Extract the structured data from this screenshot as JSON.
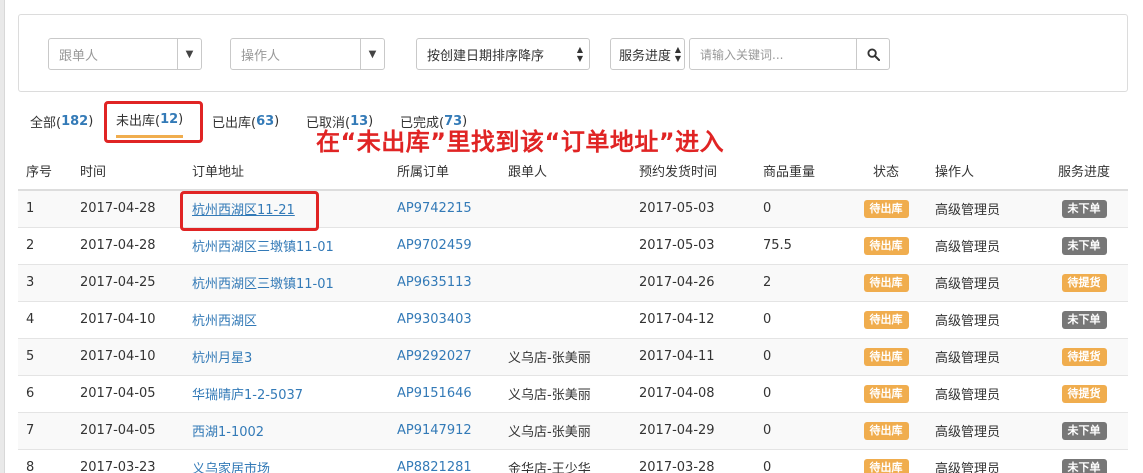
{
  "filters": {
    "follower_placeholder": "跟单人",
    "operator_placeholder": "操作人",
    "sort_value": "按创建日期排序降序",
    "progress_value": "服务进度",
    "search_placeholder": "请输入关键词..."
  },
  "tabs": [
    {
      "label": "全部(",
      "count": "182",
      "close": ")"
    },
    {
      "label": "未出库(",
      "count": "12",
      "close": ")"
    },
    {
      "label": "已出库(",
      "count": "63",
      "close": ")"
    },
    {
      "label": "已取消(",
      "count": "13",
      "close": ")"
    },
    {
      "label": "已完成(",
      "count": "73",
      "close": ")"
    }
  ],
  "annotation": "在“未出库”里找到该“订单地址”进入",
  "table": {
    "headers": [
      "序号",
      "时间",
      "订单地址",
      "所属订单",
      "跟单人",
      "预约发货时间",
      "商品重量",
      "状态",
      "操作人",
      "服务进度"
    ],
    "rows": [
      [
        "1",
        "2017-04-28",
        "杭州西湖区11-21",
        "AP9742215",
        "",
        "2017-05-03",
        "0",
        "待出库",
        "高级管理员",
        "未下单"
      ],
      [
        "2",
        "2017-04-28",
        "杭州西湖区三墩镇11-01",
        "AP9702459",
        "",
        "2017-05-03",
        "75.5",
        "待出库",
        "高级管理员",
        "未下单"
      ],
      [
        "3",
        "2017-04-25",
        "杭州西湖区三墩镇11-01",
        "AP9635113",
        "",
        "2017-04-26",
        "2",
        "待出库",
        "高级管理员",
        "待提货"
      ],
      [
        "4",
        "2017-04-10",
        "杭州西湖区",
        "AP9303403",
        "",
        "2017-04-12",
        "0",
        "待出库",
        "高级管理员",
        "未下单"
      ],
      [
        "5",
        "2017-04-10",
        "杭州月星3",
        "AP9292027",
        "义乌店-张美丽",
        "2017-04-11",
        "0",
        "待出库",
        "高级管理员",
        "待提货"
      ],
      [
        "6",
        "2017-04-05",
        "华瑞晴庐1-2-5037",
        "AP9151646",
        "义乌店-张美丽",
        "2017-04-08",
        "0",
        "待出库",
        "高级管理员",
        "待提货"
      ],
      [
        "7",
        "2017-04-05",
        "西湖1-1002",
        "AP9147912",
        "义乌店-张美丽",
        "2017-04-29",
        "0",
        "待出库",
        "高级管理员",
        "未下单"
      ],
      [
        "8",
        "2017-03-23",
        "义乌家居市场",
        "AP8821281",
        "金华店-王少华",
        "2017-03-28",
        "0",
        "待出库",
        "高级管理员",
        "未下单"
      ]
    ],
    "progress_colors": {
      "未下单": "#777777",
      "待提货": "#f0ad4e"
    },
    "status_color": "#f0ad4e"
  },
  "colors": {
    "accent": "#337ab7",
    "highlight": "#e02424",
    "tab_underline": "#f0ad4e"
  }
}
